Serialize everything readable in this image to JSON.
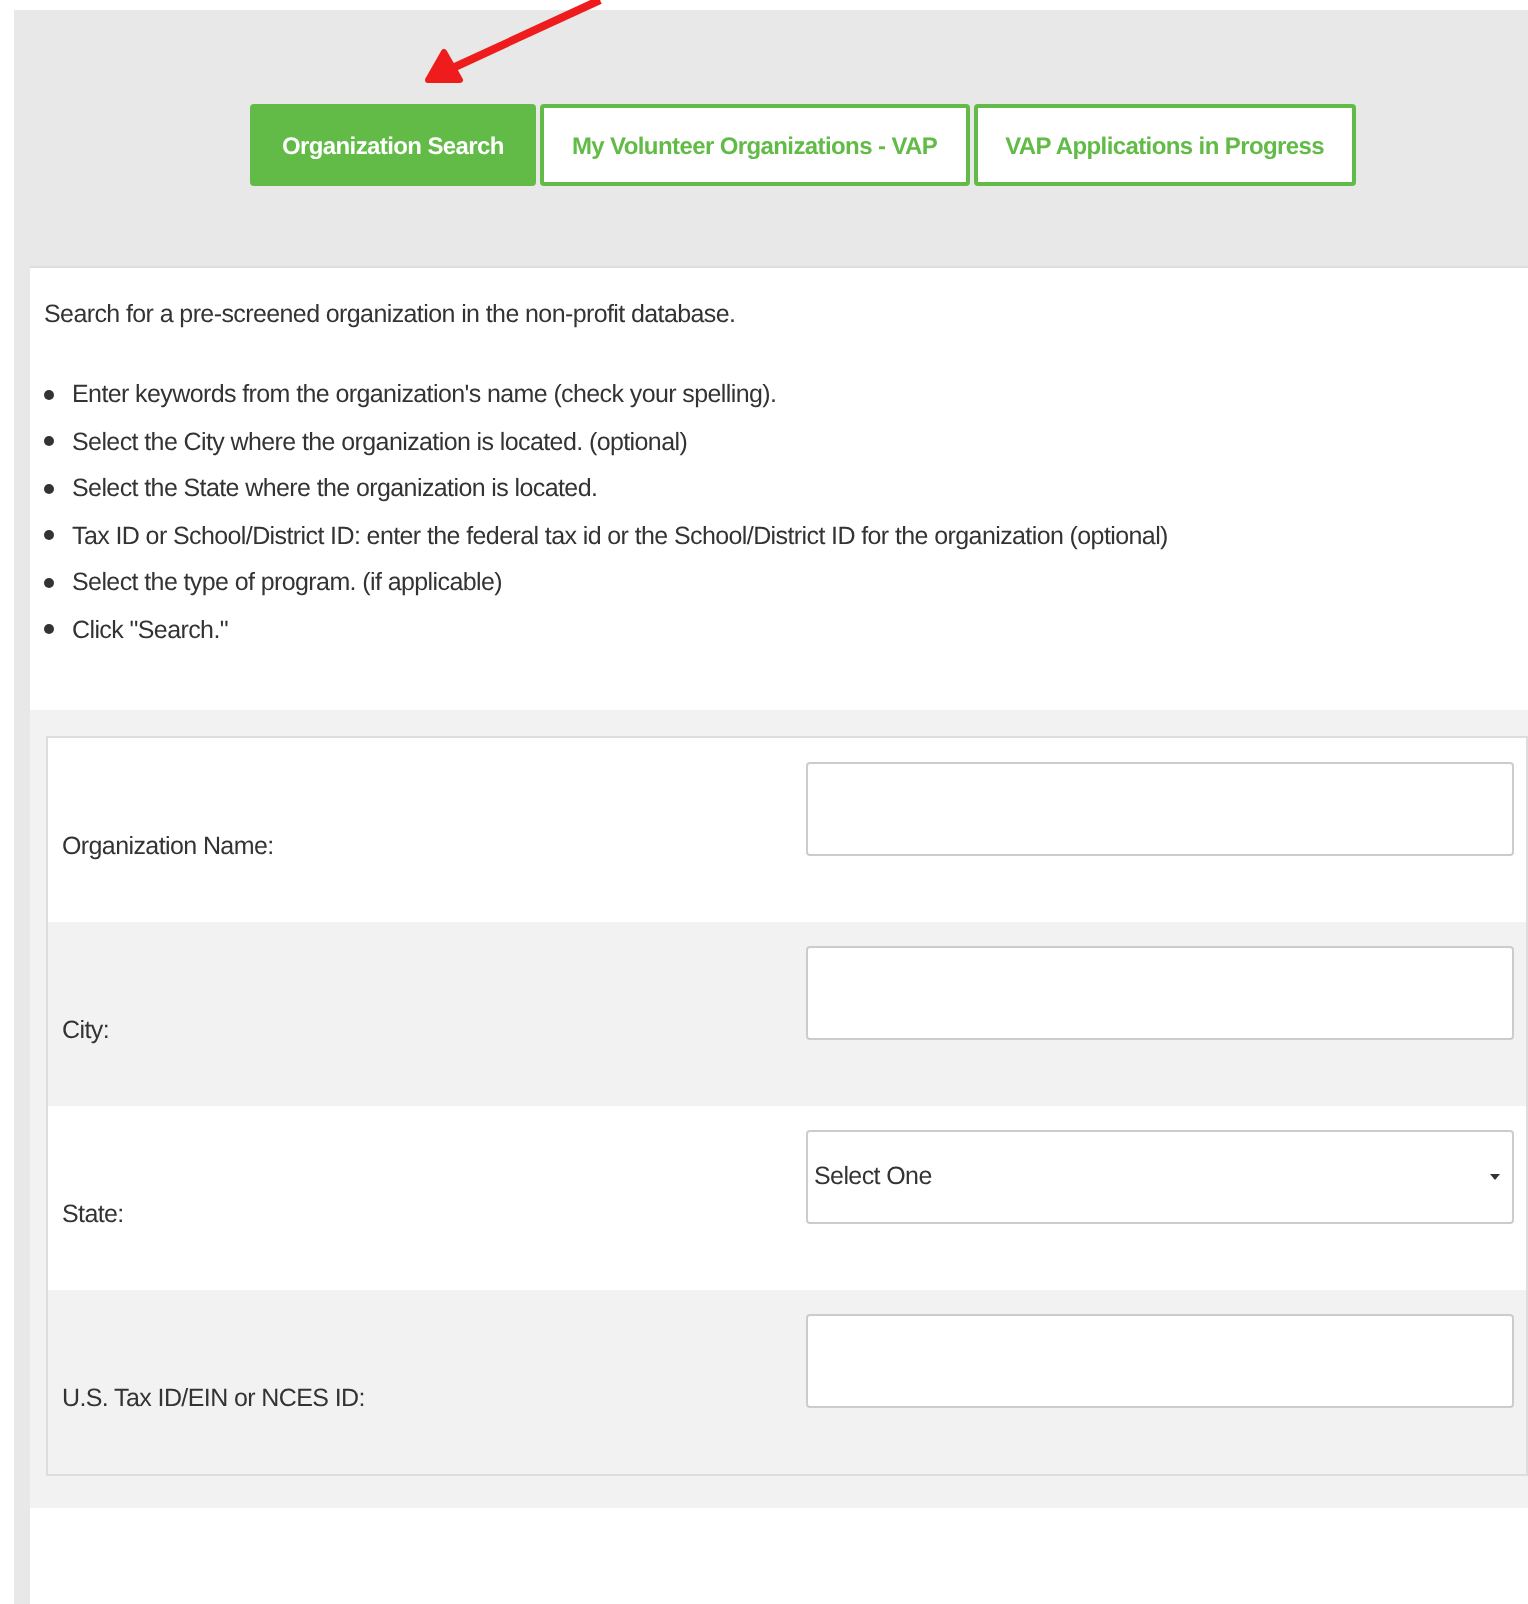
{
  "tabs": [
    {
      "label": "Organization Search",
      "selected": true
    },
    {
      "label": "My Volunteer Organizations - VAP",
      "selected": false
    },
    {
      "label": "VAP Applications in Progress",
      "selected": false
    }
  ],
  "intro": "Search for a pre-screened organization in the non-profit database.",
  "instructions": [
    "Enter keywords from the organization's name (check your spelling).",
    "Select the City where the organization is located. (optional)",
    "Select the State where the organization is located.",
    "Tax ID or School/District ID: enter the federal tax id or the School/District ID for the organization (optional)",
    "Select the type of program. (if applicable)",
    "Click \"Search.\""
  ],
  "form": [
    {
      "label": "Organization Name:",
      "kind": "text"
    },
    {
      "label": "City:",
      "kind": "text"
    },
    {
      "label": "State:",
      "kind": "select",
      "value": "Select One"
    },
    {
      "label": "U.S. Tax ID/EIN or NCES ID:",
      "kind": "text"
    }
  ]
}
